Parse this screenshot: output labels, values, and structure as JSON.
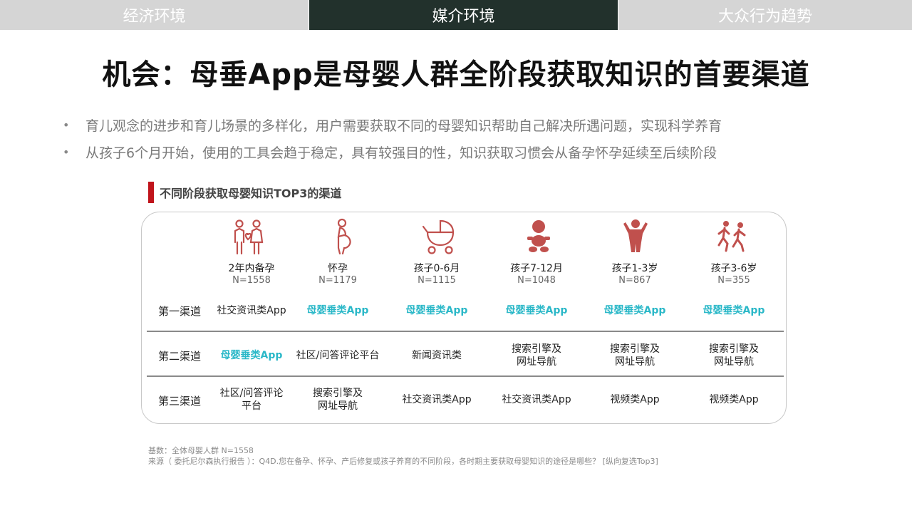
{
  "tabs": [
    "经济环境",
    "媒介环境",
    "大众行为趋势"
  ],
  "title": "机会：母垂App是母婴人群全阶段获取知识的首要渠道",
  "bullets": [
    "育儿观念的进步和育儿场景的多样化，用户需要获取不同的母婴知识帮助自己解决所遇问题，实现科学养育",
    "从孩子6个月开始，使用的工具会趋于稳定，具有较强目的性，知识获取习惯会从备孕怀孕延续至后续阶段"
  ],
  "bullet_marker": "•",
  "table_title": "不同阶段获取母婴知识TOP3的渠道",
  "colors": {
    "accent_red": "#c0141b",
    "highlight": "#2bb8c8",
    "icon": "#c0504d",
    "active_tab": "#22312c"
  },
  "stages": [
    {
      "name": "2年内备孕",
      "n": "N=1558",
      "icon": "couple-heart-icon"
    },
    {
      "name": "怀孕",
      "n": "N=1179",
      "icon": "pregnant-woman-icon"
    },
    {
      "name": "孩子0-6月",
      "n": "N=1115",
      "icon": "baby-stroller-icon"
    },
    {
      "name": "孩子7-12月",
      "n": "N=1048",
      "icon": "baby-crawling-icon"
    },
    {
      "name": "孩子1-3岁",
      "n": "N=867",
      "icon": "toddler-icon"
    },
    {
      "name": "孩子3-6岁",
      "n": "N=355",
      "icon": "running-child-icon"
    }
  ],
  "rows": [
    {
      "label": "第一渠道",
      "cells": [
        {
          "line1": "社交资讯类App",
          "line2": "",
          "highlight": false
        },
        {
          "line1": "母婴垂类App",
          "line2": "",
          "highlight": true
        },
        {
          "line1": "母婴垂类App",
          "line2": "",
          "highlight": true
        },
        {
          "line1": "母婴垂类App",
          "line2": "",
          "highlight": true
        },
        {
          "line1": "母婴垂类App",
          "line2": "",
          "highlight": true
        },
        {
          "line1": "母婴垂类App",
          "line2": "",
          "highlight": true
        }
      ]
    },
    {
      "label": "第二渠道",
      "cells": [
        {
          "line1": "母婴垂类App",
          "line2": "",
          "highlight": true
        },
        {
          "line1": "社区/问答评论平台",
          "line2": "",
          "highlight": false
        },
        {
          "line1": "新闻资讯类",
          "line2": "",
          "highlight": false
        },
        {
          "line1": "搜索引擎及",
          "line2": "网址导航",
          "highlight": false
        },
        {
          "line1": "搜索引擎及",
          "line2": "网址导航",
          "highlight": false
        },
        {
          "line1": "搜索引擎及",
          "line2": "网址导航",
          "highlight": false
        }
      ]
    },
    {
      "label": "第三渠道",
      "cells": [
        {
          "line1": "社区/问答评论",
          "line2": "平台",
          "highlight": false
        },
        {
          "line1": "搜索引擎及",
          "line2": "网址导航",
          "highlight": false
        },
        {
          "line1": "社交资讯类App",
          "line2": "",
          "highlight": false
        },
        {
          "line1": "社交资讯类App",
          "line2": "",
          "highlight": false
        },
        {
          "line1": "视频类App",
          "line2": "",
          "highlight": false
        },
        {
          "line1": "视频类App",
          "line2": "",
          "highlight": false
        }
      ]
    }
  ],
  "footer": {
    "base": "基数：全体母婴人群 N=1558",
    "source": "来源（  委托尼尔森执行报告  ）：Q4D.您在备孕、怀孕、产后修复或孩子养育的不同阶段，各时期主要获取母婴知识的途径是哪些？ [纵向复选Top3]"
  }
}
